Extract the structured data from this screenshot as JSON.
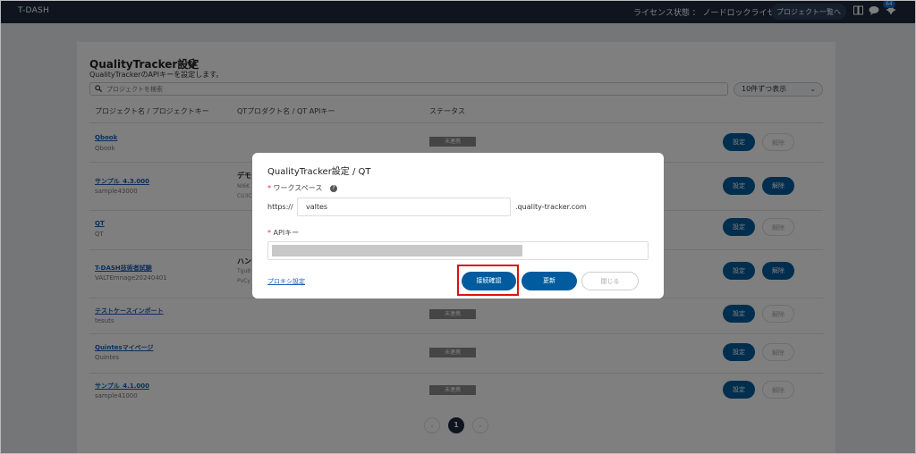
{
  "topbar": {
    "app_title": "T-DASH",
    "license_status": "ライセンス状態 ： ノードロックライセンス",
    "project_list_button": "プロジェクト一覧へ",
    "notification_count": "64"
  },
  "page": {
    "title": "QualityTracker設定",
    "subtitle": "QualityTrackerのAPIキーを設定します。",
    "search_placeholder": "プロジェクトを検索",
    "per_page": "10件ずつ表示",
    "headers": {
      "project": "プロジェクト名 / プロジェクトキー",
      "qt": "QTプロダクト名 / QT APIキー",
      "status": "ステータス"
    },
    "rows": [
      {
        "name": "Qbook",
        "key": "Qbook",
        "qt_name": "",
        "qt_key1": "",
        "qt_key2": "",
        "status": "未連携",
        "set": "設定",
        "unlink": "解除",
        "linked": false
      },
      {
        "name": "サンプル_4.3.000",
        "key": "sample43000",
        "qt_name": "デモ",
        "qt_key1": "NI6K",
        "qt_key2": "CU3C",
        "status": "",
        "set": "設定",
        "unlink": "解除",
        "linked": true
      },
      {
        "name": "QT",
        "key": "QT",
        "qt_name": "",
        "qt_key1": "",
        "qt_key2": "",
        "status": "",
        "set": "設定",
        "unlink": "解除",
        "linked": false
      },
      {
        "name": "T-DASH技術者試験",
        "key": "VALTEmnage20240401",
        "qt_name": "ハン",
        "qt_key1": "Tgu8",
        "qt_key2": "PvCy",
        "status": "",
        "set": "設定",
        "unlink": "解除",
        "linked": true
      },
      {
        "name": "テストケースインポート",
        "key": "tesuts",
        "qt_name": "",
        "qt_key1": "",
        "qt_key2": "",
        "status": "未連携",
        "set": "設定",
        "unlink": "解除",
        "linked": false
      },
      {
        "name": "Quintesマイページ",
        "key": "Quintes",
        "qt_name": "",
        "qt_key1": "",
        "qt_key2": "",
        "status": "未連携",
        "set": "設定",
        "unlink": "解除",
        "linked": false
      },
      {
        "name": "サンプル_4.1.000",
        "key": "sample41000",
        "qt_name": "",
        "qt_key1": "",
        "qt_key2": "",
        "status": "未連携",
        "set": "設定",
        "unlink": "解除",
        "linked": false
      }
    ],
    "pagination": {
      "prev": "‹",
      "current": "1",
      "next": "›"
    }
  },
  "modal": {
    "title": "QualityTracker設定 / QT",
    "workspace_label": "ワークスペース",
    "prefix": "https://",
    "workspace_value": "valtes",
    "suffix": ".quality-tracker.com",
    "api_label": "APIキー",
    "proxy_link": "プロキシ設定",
    "confirm_button": "接続確認",
    "update_button": "更新",
    "close_button": "閉じる"
  }
}
